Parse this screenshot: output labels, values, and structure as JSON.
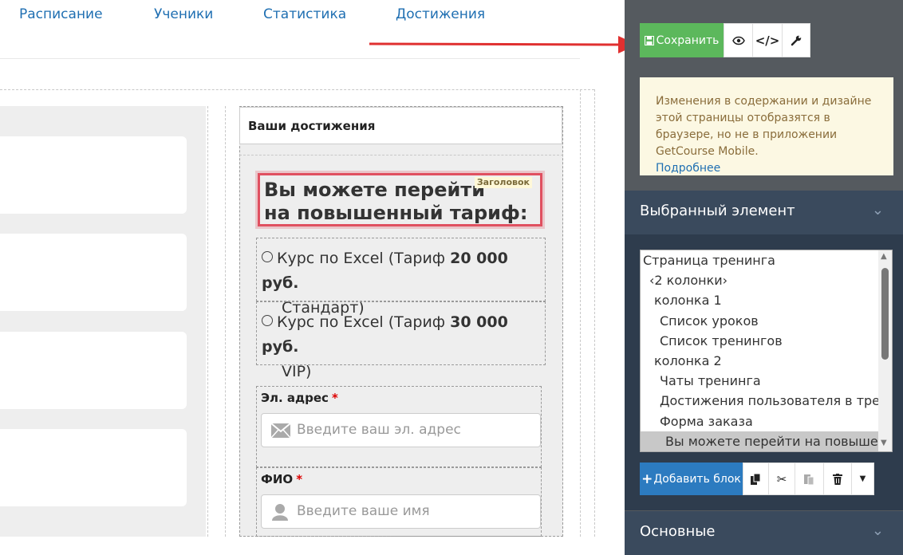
{
  "nav": [
    "Расписание",
    "Ученики",
    "Статистика",
    "Достижения"
  ],
  "achievements": {
    "title": "Ваши достижения"
  },
  "heading": {
    "line1": "Вы можете перейти",
    "line2": "на повышенный тариф:",
    "tag": "Заголовок"
  },
  "options": [
    {
      "name": "Курс по Excel (Тариф",
      "name2": "Стандарт)",
      "price": "20 000 руб."
    },
    {
      "name": "Курс по Excel (Тариф",
      "name2": "VIP)",
      "price": "30 000 руб."
    }
  ],
  "form": {
    "email_label": "Эл. адрес",
    "email_placeholder": "Введите ваш эл. адрес",
    "name_label": "ФИО",
    "name_placeholder": "Введите ваше имя",
    "required_mark": "*"
  },
  "toolbar": {
    "save_label": "Сохранить",
    "icons": [
      "eye-icon",
      "code-icon",
      "wrench-icon"
    ]
  },
  "info": {
    "text": "Изменения в содержании и дизайне этой страницы отобразятся в браузере, но не в приложении GetCourse Mobile.",
    "link": "Подробнее"
  },
  "selected_section": {
    "title": "Выбранный элемент"
  },
  "tree": [
    {
      "label": "Страница тренинга",
      "indent": 0
    },
    {
      "label": "‹2 колонки›",
      "indent": 1
    },
    {
      "label": "колонка 1",
      "indent": 2
    },
    {
      "label": "Список уроков",
      "indent": 3
    },
    {
      "label": "Список тренингов",
      "indent": 3
    },
    {
      "label": "колонка 2",
      "indent": 2
    },
    {
      "label": "Чаты тренинга",
      "indent": 3
    },
    {
      "label": "Достижения пользователя в трен",
      "indent": 3
    },
    {
      "label": "Форма заказа",
      "indent": 3
    },
    {
      "label": "Вы можете перейти на повышенн",
      "indent": 4,
      "selected": true
    }
  ],
  "actions": {
    "add_block_label": "Добавить блок",
    "add_icon": "+"
  },
  "basic_section": {
    "title": "Основные"
  },
  "colors": {
    "save": "#5cb85c",
    "add_block": "#2c7bc0",
    "panel": "#555a5f",
    "section_head": "#3a4a5d",
    "highlight": "#e05060",
    "link": "#1f6fb2"
  }
}
